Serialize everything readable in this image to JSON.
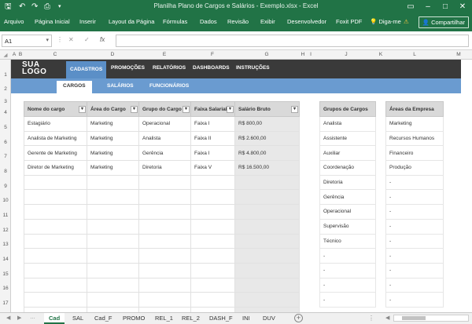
{
  "titlebar": {
    "title": "Planilha Plano de Cargos e Salários - Exemplo.xlsx - Excel",
    "save_icon": "save-icon",
    "undo_icon": "undo-icon",
    "redo_icon": "redo-icon"
  },
  "ribbon": {
    "tabs": [
      "Arquivo",
      "Página Inicial",
      "Inserir",
      "Layout da Página",
      "Fórmulas",
      "Dados",
      "Revisão",
      "Exibir",
      "Desenvolvedor",
      "Foxit PDF"
    ],
    "tell_me": "Diga-me",
    "share": "Compartilhar",
    "accent": "#217346"
  },
  "formula_bar": {
    "name_box": "A1",
    "cancel": "✕",
    "enter": "✓",
    "fx": "fx",
    "value": ""
  },
  "columns": [
    "A",
    "B",
    "C",
    "D",
    "E",
    "F",
    "G",
    "H",
    "I",
    "J",
    "K",
    "L",
    "M"
  ],
  "rows": [
    "1",
    "2",
    "3",
    "4",
    "5",
    "6",
    "7",
    "8",
    "9",
    "10",
    "11",
    "12",
    "13",
    "14",
    "15",
    "16",
    "17"
  ],
  "header_nav": {
    "logo_line1": "SUA",
    "logo_line2": "LOGO",
    "tabs": [
      "CADASTROS",
      "PROMOÇÕES",
      "RELATÓRIOS",
      "DASHBOARDS",
      "INSTRUÇÕES"
    ],
    "active_tab": "CADASTROS"
  },
  "sub_nav": {
    "tabs": [
      "CARGOS",
      "SALÁRIOS",
      "FUNCIONÁRIOS"
    ],
    "active_tab": "CARGOS"
  },
  "main_table": {
    "headers": [
      "Nome do cargo",
      "Área do Cargo",
      "Grupo do Cargo",
      "Faixa Salarial",
      "Salário Bruto"
    ],
    "rows": [
      [
        "Estagiário",
        "Marketing",
        "Operacional",
        "Faixa I",
        "R$ 800,00"
      ],
      [
        "Analista de Marketing",
        "Marketing",
        "Analista",
        "Faixa II",
        "R$ 2.600,00"
      ],
      [
        "Gerente de Marketing",
        "Marketing",
        "Gerência",
        "Faixa I",
        "R$ 4.800,00"
      ],
      [
        "Diretor de Marketing",
        "Marketing",
        "Diretoria",
        "Faixa V",
        "R$ 16.500,00"
      ]
    ]
  },
  "groups_table": {
    "header": "Grupos de Cargos",
    "items": [
      "Analista",
      "Assistente",
      "Auxiliar",
      "Coordenação",
      "Diretoria",
      "Gerência",
      "Operacional",
      "Supervisão",
      "Técnico",
      "-",
      "-",
      "-",
      "-"
    ]
  },
  "areas_table": {
    "header": "Áreas da Empresa",
    "items": [
      "Marketing",
      "Recursos Humanos",
      "Financeiro",
      "Produção",
      "-",
      "-",
      "-",
      "-",
      "-",
      "-",
      "-",
      "-",
      "-"
    ]
  },
  "sheet_tabs": {
    "tabs": [
      "Cad",
      "SAL",
      "Cad_F",
      "PROMO",
      "REL_1",
      "REL_2",
      "DASH_F",
      "INI",
      "DUV"
    ],
    "active": "Cad"
  }
}
